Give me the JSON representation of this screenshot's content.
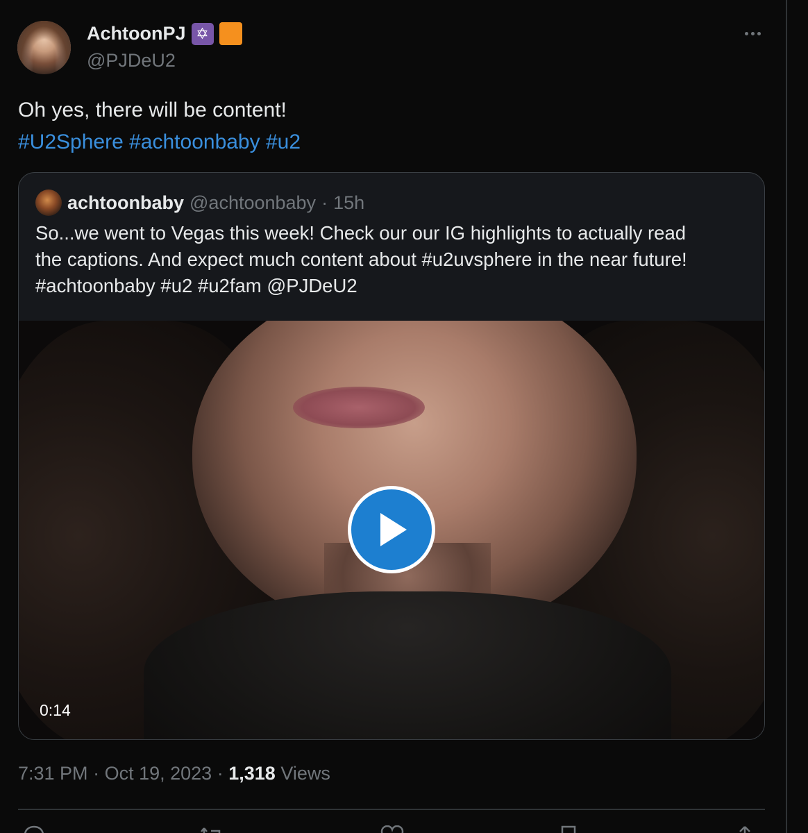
{
  "author": {
    "display_name": "AchtoonPJ",
    "handle": "@PJDeU2",
    "badge_star": "✡",
    "badge_orange_color": "#f5901e"
  },
  "tweet": {
    "text": "Oh yes, there will be content!",
    "hashtags": [
      "#U2Sphere",
      "#achtoonbaby",
      "#u2"
    ]
  },
  "quoted": {
    "name": "achtoonbaby",
    "handle": "@achtoonbaby",
    "separator": "·",
    "age": "15h",
    "text_line1": "So...we went to Vegas this week! Check our our IG highlights to actually read",
    "text_line2": "the captions. And expect much content about #u2uvsphere in the near future!",
    "text_line3": "#achtoonbaby #u2 #u2fam @PJDeU2",
    "video_duration": "0:14"
  },
  "meta": {
    "time": "7:31 PM",
    "date": "Oct 19, 2023",
    "sep1": "·",
    "sep2": "·",
    "views_count": "1,318",
    "views_label": "Views"
  },
  "icons": {
    "more": "more-horizontal-icon",
    "play": "play-icon",
    "actions": [
      "reply-icon",
      "retweet-icon",
      "like-icon",
      "bookmark-icon",
      "share-icon"
    ]
  },
  "colors": {
    "background": "#0a0a0a",
    "link": "#1d9bf0",
    "muted": "#71767b",
    "text": "#e7e9ea",
    "play_button": "#1d7fd0"
  }
}
